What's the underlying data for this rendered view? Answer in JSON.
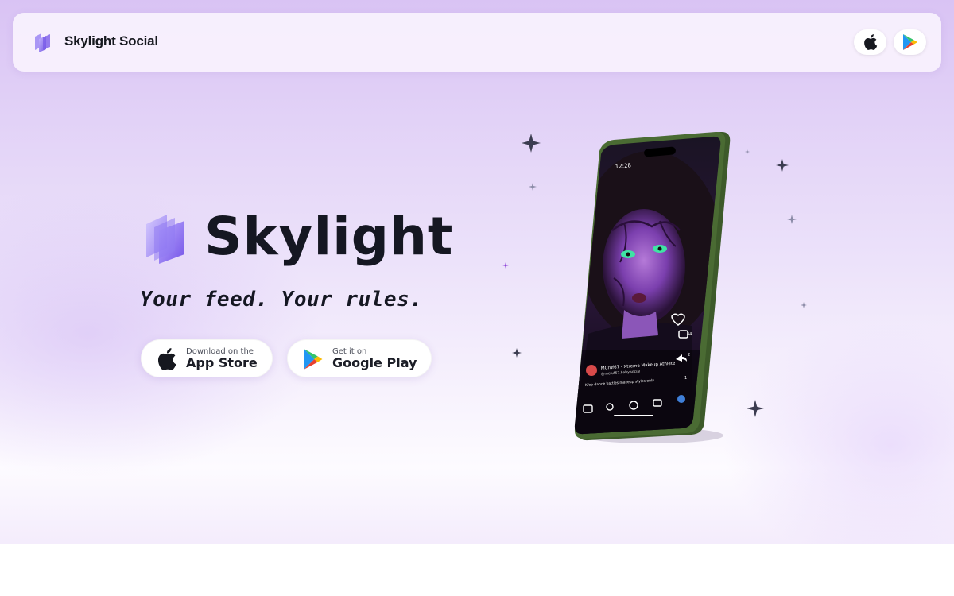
{
  "navbar": {
    "brand": "Skylight Social",
    "apple_icon": "apple-logo-icon",
    "play_icon": "google-play-icon"
  },
  "hero": {
    "title": "Skylight",
    "tagline": "Your feed. Your rules."
  },
  "buttons": {
    "appstore_small": "Download on the",
    "appstore_big": "App Store",
    "gplay_small": "Get it on",
    "gplay_big": "Google Play"
  },
  "phone": {
    "time": "12:28",
    "caption_user": "MCruf67 - Xtreme Makeup Athlete",
    "caption_handle": "@mcruf67.baby.social",
    "caption_text": "Kfop dance battles makeup styles only",
    "like_count": "44",
    "comment_count": "2",
    "share_count": "1"
  },
  "colors": {
    "accent": "#7b5ce6",
    "text_dark": "#151722",
    "phone_frame": "#4a6b33"
  }
}
